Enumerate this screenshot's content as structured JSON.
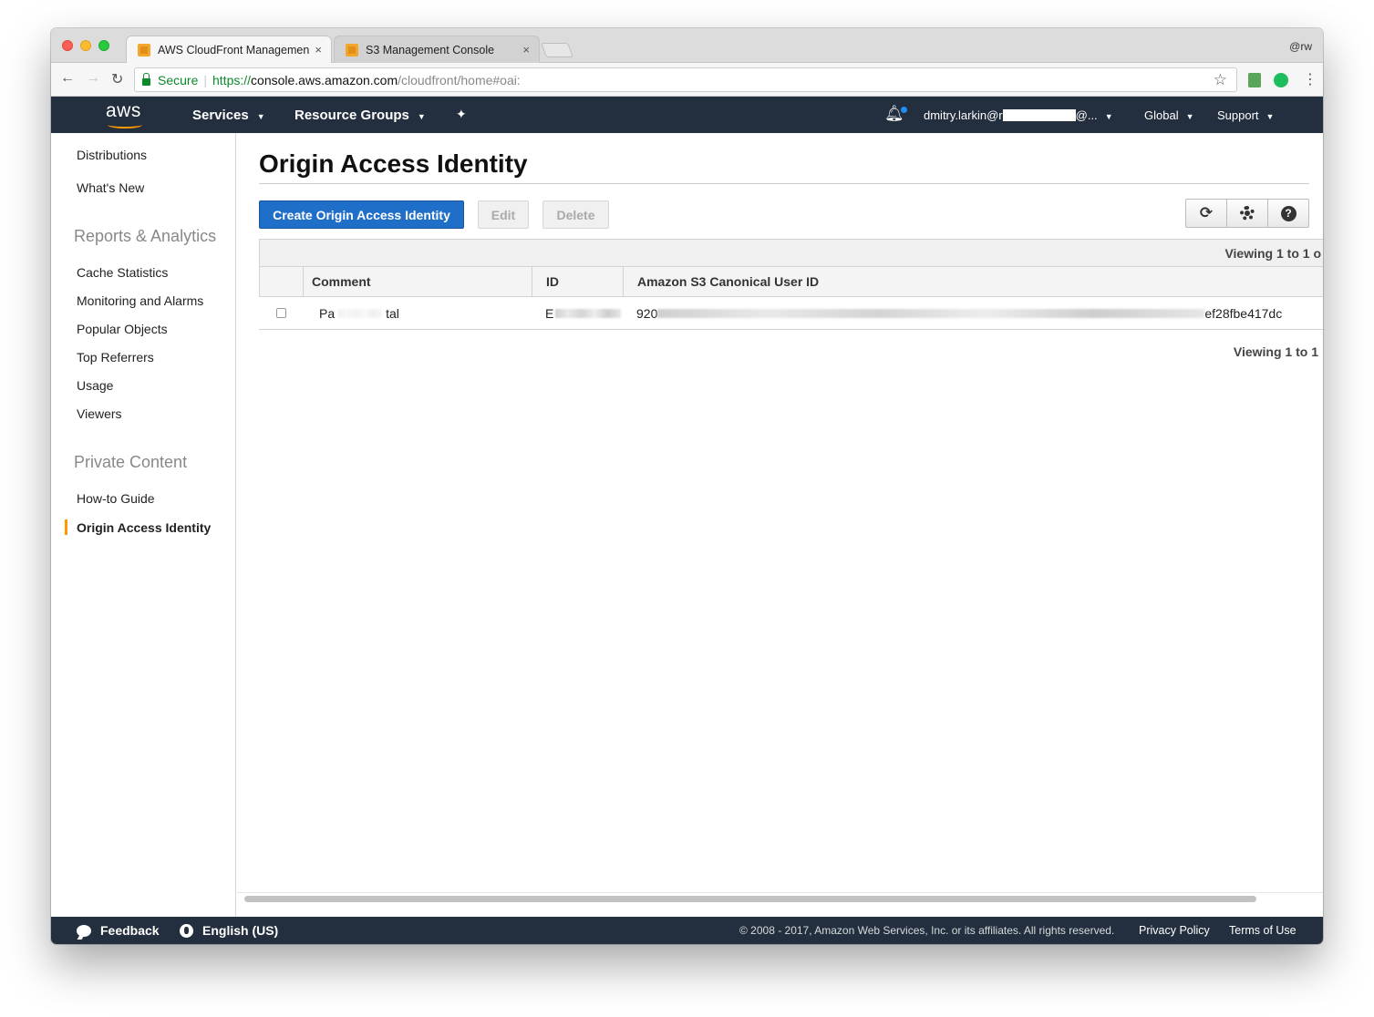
{
  "browser": {
    "tabs": [
      {
        "title": "AWS CloudFront Management",
        "close": "×"
      },
      {
        "title": "S3 Management Console",
        "close": "×"
      }
    ],
    "profile": "@rw",
    "secure_label": "Secure",
    "url_proto": "https://",
    "url_host": "console.aws.amazon.com",
    "url_path": "/cloudfront/home#oai:"
  },
  "header": {
    "logo": "aws",
    "services": "Services",
    "resource_groups": "Resource Groups",
    "account_prefix": "dmitry.larkin@r",
    "account_suffix": "@...",
    "region": "Global",
    "support": "Support"
  },
  "sidebar": {
    "top_links": [
      "Distributions",
      "What's New"
    ],
    "reports_heading": "Reports & Analytics",
    "reports_links": [
      "Cache Statistics",
      "Monitoring and Alarms",
      "Popular Objects",
      "Top Referrers",
      "Usage",
      "Viewers"
    ],
    "private_heading": "Private Content",
    "private_links": [
      "How-to Guide",
      "Origin Access Identity"
    ]
  },
  "main": {
    "title": "Origin Access Identity",
    "create_button": "Create Origin Access Identity",
    "edit_button": "Edit",
    "delete_button": "Delete",
    "viewing_top": "Viewing 1 to 1 o",
    "viewing_bottom": "Viewing 1 to 1",
    "columns": [
      "Comment",
      "ID",
      "Amazon S3 Canonical User ID"
    ],
    "row": {
      "comment_start": "Pa",
      "comment_end": "tal",
      "id_start": "E",
      "canon_start": "920",
      "canon_end": "ef28fbe417dc"
    }
  },
  "footer": {
    "feedback": "Feedback",
    "language": "English (US)",
    "copyright": "© 2008 - 2017, Amazon Web Services, Inc. or its affiliates. All rights reserved.",
    "privacy": "Privacy Policy",
    "terms": "Terms of Use"
  },
  "colors": {
    "nav_bg": "#232f3e",
    "primary": "#1f6fc9",
    "active_bar": "#ff9900"
  }
}
